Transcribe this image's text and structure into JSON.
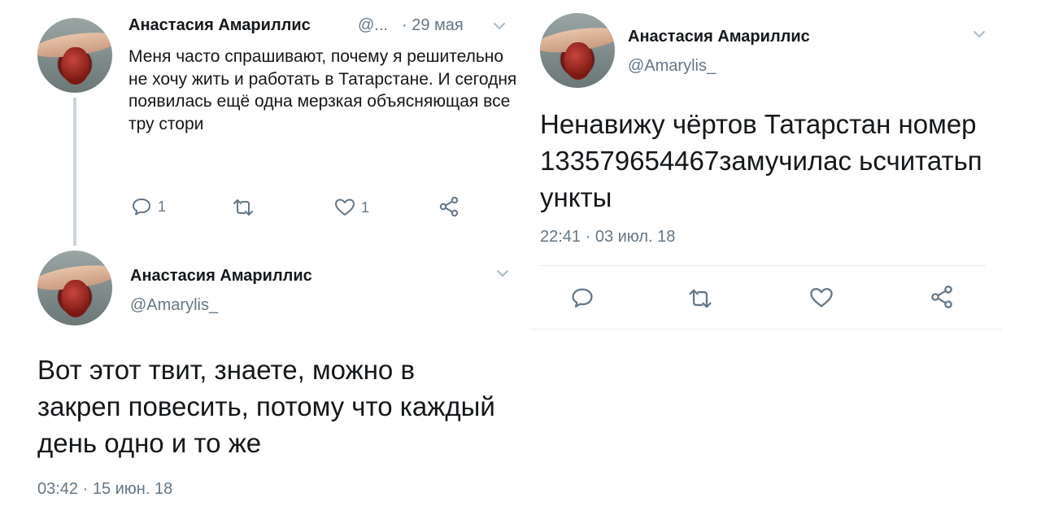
{
  "tweet1": {
    "name": "Анастасия Амариллис",
    "handle_short": "@...",
    "date": "· 29 мая",
    "text": "Меня часто спрашивают, почему я решительно не хочу жить и работать в Татарстане. И сегодня появилась ещё одна мерзкая объясняющая все тру стори",
    "reply_count": "1",
    "like_count": "1",
    "icons": [
      "reply-icon",
      "retweet-icon",
      "like-icon",
      "share-icon"
    ]
  },
  "tweet2": {
    "name": "Анастасия Амариллис",
    "handle": "@Amarylis_",
    "text": "Вот этот твит, знаете, можно в закреп повесить, потому что каждый день одно и то же",
    "timestamp": "03:42 · 15 июн. 18"
  },
  "tweet3": {
    "name": "Анастасия Амариллис",
    "handle": "@Amarylis_",
    "text": "Ненавижу чёртов Татарстан номер 133579654467замучилас ьсчитатьпункты",
    "timestamp": "22:41 · 03 июл. 18",
    "icons": [
      "reply-icon",
      "retweet-icon",
      "like-icon",
      "share-icon"
    ]
  },
  "colors": {
    "text": "#14171a",
    "muted": "#657786",
    "divider": "#e6ecf0",
    "thread_line": "#ccd6dd"
  }
}
